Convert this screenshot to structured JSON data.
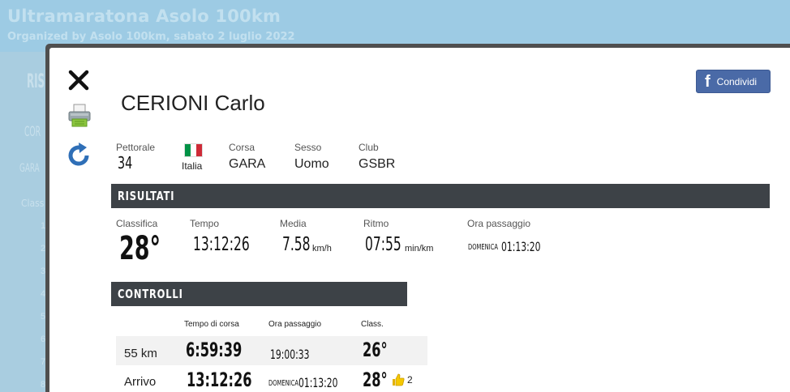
{
  "background": {
    "title": "Ultramaratona Asolo 100km",
    "subtitle": "Organized by Asolo 100km, sabato 2 luglio 2022",
    "fragments": [
      "RIS",
      "COR",
      "GARA",
      "Class"
    ],
    "rank_numbers": [
      "1",
      "2",
      "3",
      "4",
      "5",
      "6",
      "7",
      "8"
    ]
  },
  "toolbar": {
    "close_icon": "close-icon",
    "print_icon": "printer-icon",
    "refresh_icon": "refresh-icon"
  },
  "share": {
    "label": "Condividi",
    "icon": "facebook-icon",
    "color": "#4a6aa7"
  },
  "athlete": {
    "name": "CERIONI Carlo",
    "bib_label": "Pettorale",
    "bib": "34",
    "country": "Italia",
    "flag_colors": [
      "#009246",
      "#ffffff",
      "#ce2b37"
    ],
    "race_label": "Corsa",
    "race": "GARA",
    "sex_label": "Sesso",
    "sex": "Uomo",
    "club_label": "Club",
    "club": "GSBR"
  },
  "results": {
    "section_title": "RISULTATI",
    "rank_label": "Classifica",
    "rank": "28°",
    "time_label": "Tempo",
    "time": "13:12:26",
    "avg_label": "Media",
    "avg": "7.58",
    "avg_unit": "km/h",
    "pace_label": "Ritmo",
    "pace": "07:55",
    "pace_unit": "min/km",
    "passage_label": "Ora passaggio",
    "passage_day": "DOMENICA",
    "passage_time": "01:13:20"
  },
  "controls": {
    "section_title": "CONTROLLI",
    "headers": {
      "race_time": "Tempo di corsa",
      "passage": "Ora passaggio",
      "rank": "Class."
    },
    "rows": [
      {
        "name": "55 km",
        "race_time": "6:59:39",
        "passage": "19:00:33",
        "rank": "26°"
      },
      {
        "name": "Arrivo",
        "race_time": "13:12:26",
        "passage_day": "DOMENICA",
        "passage": "01:13:20",
        "rank": "28°",
        "gain": "2",
        "gain_icon": "thumbs-up-icon"
      }
    ]
  }
}
